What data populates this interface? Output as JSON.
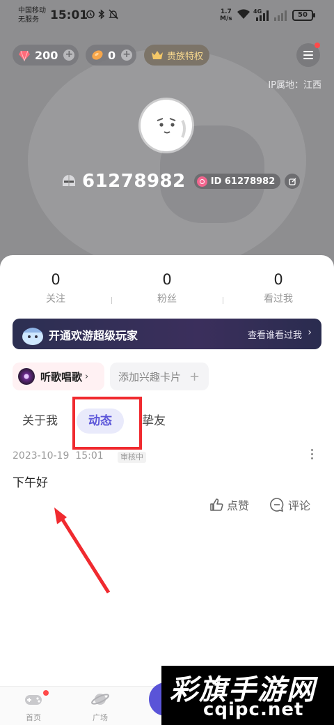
{
  "status_bar": {
    "carrier_line1": "中国移动",
    "carrier_line2": "无服务",
    "time": "15:01",
    "net_speed_value": "1.7",
    "net_speed_unit": "M/s",
    "network_type": "4G",
    "battery": "50"
  },
  "header": {
    "diamonds": "200",
    "beans": "0",
    "noble_label": "贵族特权",
    "ip_location": "IP属地：江西"
  },
  "profile": {
    "username": "61278982",
    "id_label": "ID 61278982"
  },
  "stats": [
    {
      "value": "0",
      "label": "关注"
    },
    {
      "value": "0",
      "label": "粉丝"
    },
    {
      "value": "0",
      "label": "看过我"
    }
  ],
  "vip_banner": {
    "title": "开通欢游超级玩家",
    "link": "查看谁看过我"
  },
  "interests": {
    "tag": "听歌唱歌",
    "add_label": "添加兴趣卡片"
  },
  "tabs": [
    "关于我",
    "动态",
    "挚友"
  ],
  "post": {
    "date": "2023-10-19",
    "time": "15:01",
    "status": "审核中",
    "text": "下午好",
    "like_label": "点赞",
    "comment_label": "评论"
  },
  "bottom_nav": [
    {
      "label": "首页"
    },
    {
      "label": "广场"
    }
  ],
  "watermark": {
    "title": "彩旗手游网",
    "url": "cqipc.net"
  },
  "colors": {
    "accent": "#5b55d9",
    "highlight_box": "#f02a2f",
    "banner_bg": "#2c2f52"
  }
}
